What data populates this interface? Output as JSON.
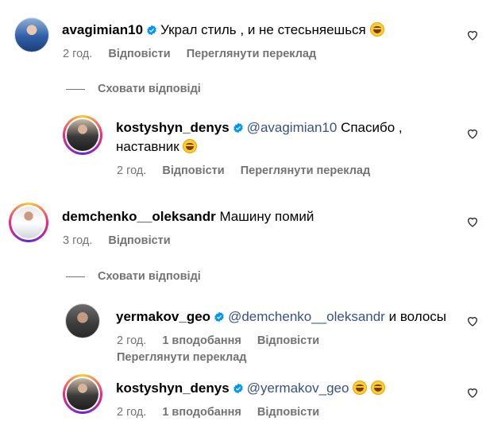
{
  "comments": [
    {
      "username": "avagimian10",
      "verified": true,
      "text": "Украл стиль , и не стесьняешься",
      "emoji": "😂",
      "time": "2 год.",
      "reply_label": "Відповісти",
      "translate_label": "Переглянути переклад",
      "hide_replies_label": "Сховати відповіді",
      "replies": [
        {
          "username": "kostyshyn_denys",
          "verified": true,
          "mention": "@avagimian10",
          "text_line1": "Спасибо ,",
          "text_line2": "наставник",
          "emoji": "😂",
          "time": "2 год.",
          "reply_label": "Відповісти",
          "translate_label": "Переглянути переклад"
        }
      ]
    },
    {
      "username": "demchenko__oleksandr",
      "verified": false,
      "text": "Машину помий",
      "time": "3 год.",
      "reply_label": "Відповісти",
      "hide_replies_label": "Сховати відповіді",
      "replies": [
        {
          "username": "yermakov_geo",
          "verified": true,
          "mention": "@demchenko__oleksandr",
          "text": "и волосы",
          "time": "2 год.",
          "likes": "1 вподобання",
          "reply_label": "Відповісти",
          "translate_label": "Переглянути переклад"
        },
        {
          "username": "kostyshyn_denys",
          "verified": true,
          "mention": "@yermakov_geo",
          "emoji": "😂😂",
          "time": "2 год.",
          "likes": "1 вподобання",
          "reply_label": "Відповісти"
        }
      ]
    }
  ],
  "icons": {
    "like": "heart-outline-icon",
    "verified": "verified-badge-icon"
  },
  "colors": {
    "verified": "#0095f6",
    "mention": "#385185",
    "meta": "#737373"
  }
}
